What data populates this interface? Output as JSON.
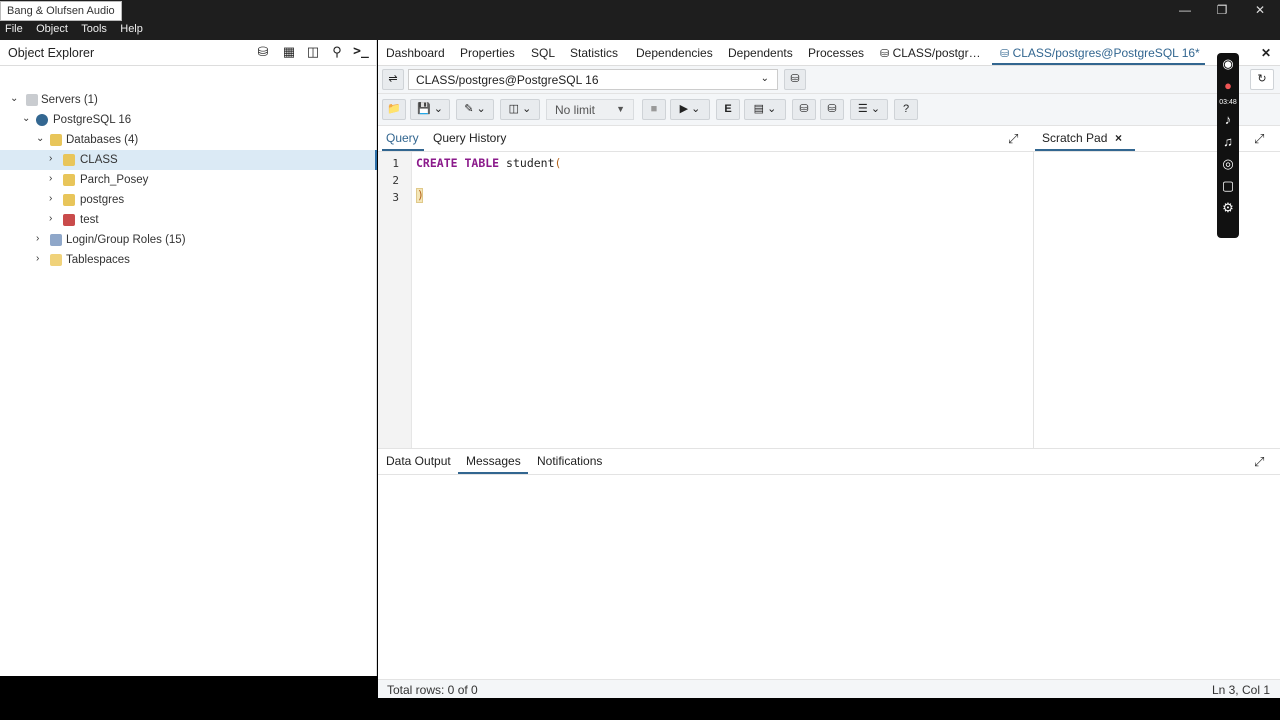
{
  "window": {
    "title": "Bang & Olufsen Audio",
    "minimize": "—",
    "restore": "❐",
    "close": "✕"
  },
  "menubar": [
    "File",
    "Object",
    "Tools",
    "Help"
  ],
  "object_explorer": {
    "title": "Object Explorer",
    "tree": {
      "servers": "Servers (1)",
      "server": "PostgreSQL 16",
      "databases": "Databases (4)",
      "db_items": [
        "CLASS",
        "Parch_Posey",
        "postgres",
        "test"
      ],
      "login_roles": "Login/Group Roles (15)",
      "tablespaces": "Tablespaces"
    }
  },
  "main_tabs": {
    "items": [
      "Dashboard",
      "Properties",
      "SQL",
      "Statistics",
      "Dependencies",
      "Dependents",
      "Processes",
      "CLASS/postgr…",
      "CLASS/postgres@PostgreSQL 16*"
    ],
    "close": "✕"
  },
  "connection": {
    "value": "CLASS/postgres@PostgreSQL 16"
  },
  "toolbar": {
    "limit_value": "No limit"
  },
  "editor_tabs": {
    "query": "Query",
    "history": "Query History",
    "scratch": "Scratch Pad",
    "scratch_close": "×"
  },
  "editor": {
    "line_numbers": [
      "1",
      "2",
      "3"
    ],
    "line1_kw1": "CREATE",
    "line1_kw2": "TABLE",
    "line1_ident": "student",
    "line1_paren": "(",
    "line3": ")"
  },
  "results_tabs": [
    "Data Output",
    "Messages",
    "Notifications"
  ],
  "status": {
    "total_rows": "Total rows: 0 of 0",
    "position": "Ln 3, Col 1"
  },
  "recorder": {
    "time": "03:48"
  }
}
